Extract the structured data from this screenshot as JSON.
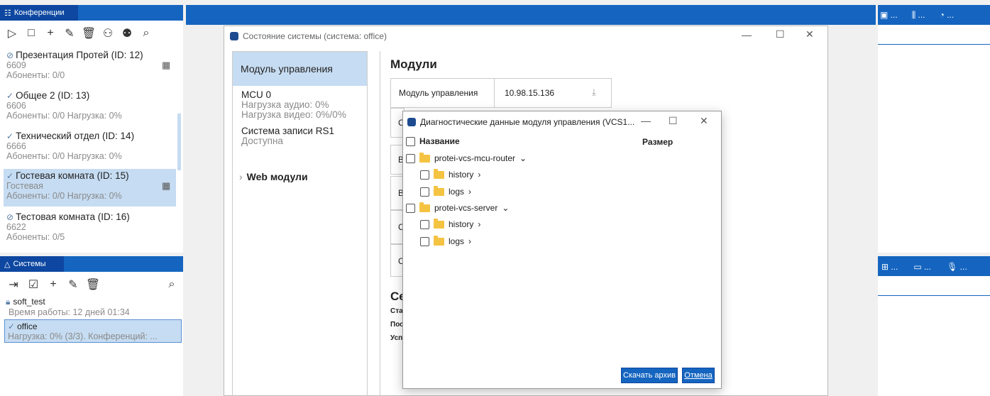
{
  "conferences": {
    "header": "Конференции",
    "items": [
      {
        "mark": "⊘",
        "title": "Презентация Протей (ID: 12)",
        "line2": "6609",
        "line3": "Абоненты: 0/0"
      },
      {
        "mark": "✓",
        "title": "Общее 2 (ID: 13)",
        "line2": "6606",
        "line3": "Абоненты: 0/0 Нагрузка: 0%"
      },
      {
        "mark": "✓",
        "title": "Технический отдел (ID: 14)",
        "line2": "6666",
        "line3": "Абоненты: 0/0 Нагрузка: 0%"
      },
      {
        "mark": "✓",
        "title": "Гостевая комната (ID: 15)",
        "line2": "Гостевая",
        "line3": "Абоненты: 0/0 Нагрузка: 0%"
      },
      {
        "mark": "⊘",
        "title": "Тестовая комната (ID: 16)",
        "line2": "6622",
        "line3": "Абоненты: 0/5"
      }
    ]
  },
  "systems": {
    "header": "Системы",
    "items": [
      {
        "title": "soft_test",
        "line2": "Время работы: 12 дней 01:34"
      },
      {
        "title": "office",
        "line2": "Нагрузка: 0% (3/3). Конференций: ..."
      }
    ]
  },
  "right_tabs_top": [
    "...",
    "...",
    "..."
  ],
  "right_tabs_mid": [
    "...",
    "...",
    "..."
  ],
  "status_window": {
    "title": "Состояние системы (система: office)",
    "left_items": [
      {
        "title": "Модуль управления"
      },
      {
        "title": "MCU 0",
        "line2": "Нагрузка аудио: 0%",
        "line3": "Нагрузка видео: 0%/0%"
      },
      {
        "title": "Система записи RS1",
        "line2": "Доступна"
      },
      {
        "title": "Web модули"
      }
    ],
    "modules_heading": "Модули",
    "module_row": {
      "name": "Модуль управления",
      "ip": "10.98.15.136"
    },
    "row_letters": [
      "С",
      "В",
      "В",
      "С",
      "С"
    ],
    "section2_heading": "Се",
    "section2_lines": [
      "Ста",
      "Пос",
      "Усп"
    ]
  },
  "diag_dialog": {
    "title": "Диагностические данные модуля управления (VCS1...",
    "col_name": "Название",
    "col_size": "Размер",
    "tree": [
      {
        "label": "protei-vcs-mcu-router",
        "arrow": "⌄",
        "level": 0
      },
      {
        "label": "history",
        "arrow": "›",
        "level": 1
      },
      {
        "label": "logs",
        "arrow": "›",
        "level": 1
      },
      {
        "label": "protei-vcs-server",
        "arrow": "⌄",
        "level": 0
      },
      {
        "label": "history",
        "arrow": "›",
        "level": 1
      },
      {
        "label": "logs",
        "arrow": "›",
        "level": 1
      }
    ],
    "download_btn": "Скачать архив",
    "cancel_btn": "Отмена"
  }
}
